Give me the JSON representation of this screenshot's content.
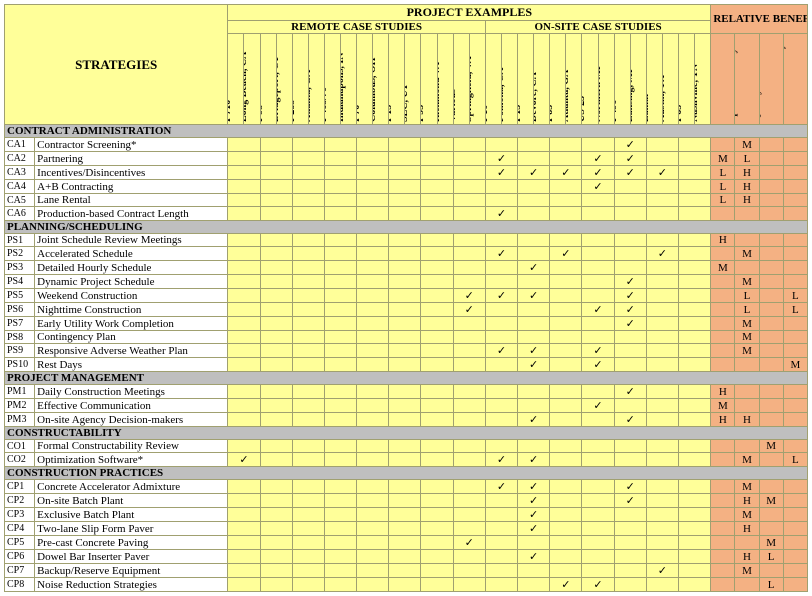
{
  "headers": {
    "strategies": "STRATEGIES",
    "project_examples": "PROJECT EXAMPLES",
    "remote": "REMOTE CASE STUDIES",
    "onsite": "ON-SITE CASE STUDIES",
    "relative": "RELATIVE BENEFIT"
  },
  "case_cols": [
    {
      "l1": "I-710",
      "l2": "Long Beach, CA"
    },
    {
      "l1": "I-95",
      "l2": "Bridgeport, CT"
    },
    {
      "l1": "I-285",
      "l2": "Atlanta, GA"
    },
    {
      "l1": "I-465/70",
      "l2": "Indianapolis, IN"
    },
    {
      "l1": "I-70",
      "l2": "Columbus, OH"
    },
    {
      "l1": "I-15",
      "l2": "SLC, UT"
    },
    {
      "l1": "I-95",
      "l2": "Richmond VA"
    },
    {
      "l1": "Various",
      "l2": "Springfield, VA"
    },
    {
      "l1": "I-10",
      "l2": "Pomona, CA"
    },
    {
      "l1": "I-15",
      "l2": "Devore, CA"
    },
    {
      "l1": "I-85",
      "l2": "Atlanta, GA"
    },
    {
      "l1": "US-23",
      "l2": "Northern MI"
    },
    {
      "l1": "I-496",
      "l2": "Lansing, MI"
    },
    {
      "l1": "Lamar",
      "l2": "Austin, TX"
    },
    {
      "l1": "I-65",
      "l2": "Nashville, TN"
    }
  ],
  "rel_cols": [
    "Communication/ Coordination",
    "Speed/ Efficiency",
    "Construction Quality",
    "Work Zone Safety"
  ],
  "sections": [
    {
      "title": "CONTRACT ADMINISTRATION",
      "rows": [
        {
          "code": "CA1",
          "name": "Contractor Screening*",
          "c": [
            "",
            "",
            "",
            "",
            "",
            "",
            "",
            "",
            "",
            "",
            "",
            "",
            "✓",
            "",
            ""
          ],
          "r": [
            "",
            "M",
            "",
            ""
          ]
        },
        {
          "code": "CA2",
          "name": "Partnering",
          "c": [
            "",
            "",
            "",
            "",
            "",
            "",
            "",
            "",
            "✓",
            "",
            "",
            "✓",
            "✓",
            "",
            ""
          ],
          "r": [
            "M",
            "L",
            "",
            ""
          ]
        },
        {
          "code": "CA3",
          "name": "Incentives/Disincentives",
          "c": [
            "",
            "",
            "",
            "",
            "",
            "",
            "",
            "",
            "✓",
            "✓",
            "✓",
            "✓",
            "✓",
            "✓",
            ""
          ],
          "r": [
            "L",
            "H",
            "",
            ""
          ]
        },
        {
          "code": "CA4",
          "name": "A+B Contracting",
          "c": [
            "",
            "",
            "",
            "",
            "",
            "",
            "",
            "",
            "",
            "",
            "",
            "✓",
            "",
            "",
            ""
          ],
          "r": [
            "L",
            "H",
            "",
            ""
          ]
        },
        {
          "code": "CA5",
          "name": "Lane Rental",
          "c": [
            "",
            "",
            "",
            "",
            "",
            "",
            "",
            "",
            "",
            "",
            "",
            "",
            "",
            "",
            ""
          ],
          "r": [
            "L",
            "H",
            "",
            ""
          ]
        },
        {
          "code": "CA6",
          "name": "Production-based Contract Length",
          "c": [
            "",
            "",
            "",
            "",
            "",
            "",
            "",
            "",
            "✓",
            "",
            "",
            "",
            "",
            "",
            ""
          ],
          "r": [
            "",
            "",
            "",
            ""
          ]
        }
      ]
    },
    {
      "title": "PLANNING/SCHEDULING",
      "rows": [
        {
          "code": "PS1",
          "name": "Joint Schedule Review Meetings",
          "c": [
            "",
            "",
            "",
            "",
            "",
            "",
            "",
            "",
            "",
            "",
            "",
            "",
            "",
            "",
            ""
          ],
          "r": [
            "H",
            "",
            "",
            ""
          ]
        },
        {
          "code": "PS2",
          "name": "Accelerated Schedule",
          "c": [
            "",
            "",
            "",
            "",
            "",
            "",
            "",
            "",
            "✓",
            "",
            "✓",
            "",
            "",
            "✓",
            ""
          ],
          "r": [
            "",
            "M",
            "",
            ""
          ]
        },
        {
          "code": "PS3",
          "name": "Detailed Hourly Schedule",
          "c": [
            "",
            "",
            "",
            "",
            "",
            "",
            "",
            "",
            "",
            "✓",
            "",
            "",
            "",
            "",
            ""
          ],
          "r": [
            "M",
            "",
            "",
            ""
          ]
        },
        {
          "code": "PS4",
          "name": "Dynamic Project Schedule",
          "c": [
            "",
            "",
            "",
            "",
            "",
            "",
            "",
            "",
            "",
            "",
            "",
            "",
            "✓",
            "",
            ""
          ],
          "r": [
            "",
            "M",
            "",
            ""
          ]
        },
        {
          "code": "PS5",
          "name": "Weekend Construction",
          "c": [
            "",
            "",
            "",
            "",
            "",
            "",
            "",
            "✓",
            "✓",
            "✓",
            "",
            "",
            "✓",
            "",
            ""
          ],
          "r": [
            "",
            "L",
            "",
            "L"
          ]
        },
        {
          "code": "PS6",
          "name": "Nighttime Construction",
          "c": [
            "",
            "",
            "",
            "",
            "",
            "",
            "",
            "✓",
            "",
            "",
            "",
            "✓",
            "✓",
            "",
            ""
          ],
          "r": [
            "",
            "L",
            "",
            "L"
          ]
        },
        {
          "code": "PS7",
          "name": "Early Utility Work Completion",
          "c": [
            "",
            "",
            "",
            "",
            "",
            "",
            "",
            "",
            "",
            "",
            "",
            "",
            "✓",
            "",
            ""
          ],
          "r": [
            "",
            "M",
            "",
            ""
          ]
        },
        {
          "code": "PS8",
          "name": "Contingency Plan",
          "c": [
            "",
            "",
            "",
            "",
            "",
            "",
            "",
            "",
            "",
            "",
            "",
            "",
            "",
            "",
            ""
          ],
          "r": [
            "",
            "M",
            "",
            ""
          ]
        },
        {
          "code": "PS9",
          "name": "Responsive Adverse Weather Plan",
          "c": [
            "",
            "",
            "",
            "",
            "",
            "",
            "",
            "",
            "✓",
            "✓",
            "",
            "✓",
            "",
            "",
            ""
          ],
          "r": [
            "",
            "M",
            "",
            ""
          ]
        },
        {
          "code": "PS10",
          "name": "Rest Days",
          "c": [
            "",
            "",
            "",
            "",
            "",
            "",
            "",
            "",
            "",
            "✓",
            "",
            "✓",
            "",
            "",
            ""
          ],
          "r": [
            "",
            "",
            "",
            "M"
          ]
        }
      ]
    },
    {
      "title": "PROJECT MANAGEMENT",
      "rows": [
        {
          "code": "PM1",
          "name": "Daily Construction Meetings",
          "c": [
            "",
            "",
            "",
            "",
            "",
            "",
            "",
            "",
            "",
            "",
            "",
            "",
            "✓",
            "",
            ""
          ],
          "r": [
            "H",
            "",
            "",
            ""
          ]
        },
        {
          "code": "PM2",
          "name": "Effective Communication",
          "c": [
            "",
            "",
            "",
            "",
            "",
            "",
            "",
            "",
            "",
            "",
            "",
            "✓",
            "",
            "",
            ""
          ],
          "r": [
            "M",
            "",
            "",
            ""
          ]
        },
        {
          "code": "PM3",
          "name": "On-site Agency Decision-makers",
          "c": [
            "",
            "",
            "",
            "",
            "",
            "",
            "",
            "",
            "",
            "✓",
            "",
            "",
            "✓",
            "",
            ""
          ],
          "r": [
            "H",
            "H",
            "",
            ""
          ]
        }
      ]
    },
    {
      "title": "CONSTRUCTABILITY",
      "rows": [
        {
          "code": "CO1",
          "name": "Formal Constructability Review",
          "c": [
            "",
            "",
            "",
            "",
            "",
            "",
            "",
            "",
            "",
            "",
            "",
            "",
            "",
            "",
            ""
          ],
          "r": [
            "",
            "",
            "M",
            ""
          ]
        },
        {
          "code": "CO2",
          "name": "Optimization Software*",
          "c": [
            "✓",
            "",
            "",
            "",
            "",
            "",
            "",
            "",
            "✓",
            "✓",
            "",
            "",
            "",
            "",
            ""
          ],
          "r": [
            "",
            "M",
            "",
            "L"
          ]
        }
      ]
    },
    {
      "title": "CONSTRUCTION PRACTICES",
      "rows": [
        {
          "code": "CP1",
          "name": "Concrete Accelerator Admixture",
          "c": [
            "",
            "",
            "",
            "",
            "",
            "",
            "",
            "",
            "✓",
            "✓",
            "",
            "",
            "✓",
            "",
            ""
          ],
          "r": [
            "",
            "M",
            "",
            ""
          ]
        },
        {
          "code": "CP2",
          "name": "On-site Batch Plant",
          "c": [
            "",
            "",
            "",
            "",
            "",
            "",
            "",
            "",
            "",
            "✓",
            "",
            "",
            "✓",
            "",
            ""
          ],
          "r": [
            "",
            "H",
            "M",
            ""
          ]
        },
        {
          "code": "CP3",
          "name": "Exclusive Batch Plant",
          "c": [
            "",
            "",
            "",
            "",
            "",
            "",
            "",
            "",
            "",
            "✓",
            "",
            "",
            "",
            "",
            ""
          ],
          "r": [
            "",
            "M",
            "",
            ""
          ]
        },
        {
          "code": "CP4",
          "name": "Two-lane Slip Form Paver",
          "c": [
            "",
            "",
            "",
            "",
            "",
            "",
            "",
            "",
            "",
            "✓",
            "",
            "",
            "",
            "",
            ""
          ],
          "r": [
            "",
            "H",
            "",
            ""
          ]
        },
        {
          "code": "CP5",
          "name": "Pre-cast Concrete Paving",
          "c": [
            "",
            "",
            "",
            "",
            "",
            "",
            "",
            "✓",
            "",
            "",
            "",
            "",
            "",
            "",
            ""
          ],
          "r": [
            "",
            "",
            "M",
            ""
          ]
        },
        {
          "code": "CP6",
          "name": "Dowel Bar Inserter Paver",
          "c": [
            "",
            "",
            "",
            "",
            "",
            "",
            "",
            "",
            "",
            "✓",
            "",
            "",
            "",
            "",
            ""
          ],
          "r": [
            "",
            "H",
            "L",
            ""
          ]
        },
        {
          "code": "CP7",
          "name": "Backup/Reserve Equipment",
          "c": [
            "",
            "",
            "",
            "",
            "",
            "",
            "",
            "",
            "",
            "",
            "",
            "",
            "",
            "✓",
            ""
          ],
          "r": [
            "",
            "M",
            "",
            ""
          ]
        },
        {
          "code": "CP8",
          "name": "Noise Reduction Strategies",
          "c": [
            "",
            "",
            "",
            "",
            "",
            "",
            "",
            "",
            "",
            "",
            "✓",
            "✓",
            "",
            "",
            ""
          ],
          "r": [
            "",
            "",
            "L",
            ""
          ]
        }
      ]
    }
  ]
}
